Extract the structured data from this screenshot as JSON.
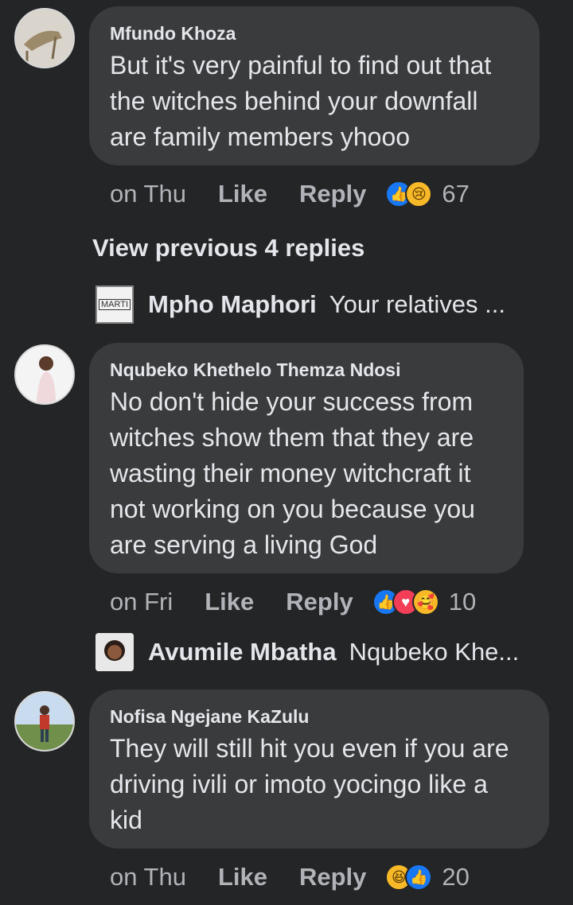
{
  "comments": [
    {
      "author": "Mfundo Khoza",
      "text_lines": [
        "But it's very painful to find out that",
        "the witches behind your downfall",
        "are family members yhooo"
      ],
      "time": "on Thu",
      "like_label": "Like",
      "reply_label": "Reply",
      "reactions": [
        "like",
        "sad"
      ],
      "reaction_count": "67"
    },
    {
      "author": "Nqubeko Khethelo Themza Ndosi",
      "text_lines": [
        "No don't hide your success from",
        "witches show them that they are",
        "wasting their money witchcraft it",
        "not working on you because you",
        "are serving a living God"
      ],
      "time": "on Fri",
      "like_label": "Like",
      "reply_label": "Reply",
      "reactions": [
        "like",
        "love",
        "care"
      ],
      "reaction_count": "10"
    },
    {
      "author": "Nofisa Ngejane KaZulu",
      "text_lines": [
        "They will still hit you even if you are",
        "driving ivili or imoto yocingo like a",
        "kid"
      ],
      "time": "on Thu",
      "like_label": "Like",
      "reply_label": "Reply",
      "reactions": [
        "haha",
        "like"
      ],
      "reaction_count": "20"
    }
  ],
  "view_previous": "View previous 4 replies",
  "replies": [
    {
      "author": "Mpho Maphori",
      "preview": "Your relatives ...",
      "avatar_text": "MARTI"
    },
    {
      "author": "Avumile Mbatha",
      "preview": "Nqubeko Khe..."
    }
  ],
  "colors": {
    "background": "#242526",
    "bubble": "#3a3b3c",
    "text": "#e4e6eb",
    "muted": "#b0b3b8",
    "like_blue": "#1877f2"
  }
}
